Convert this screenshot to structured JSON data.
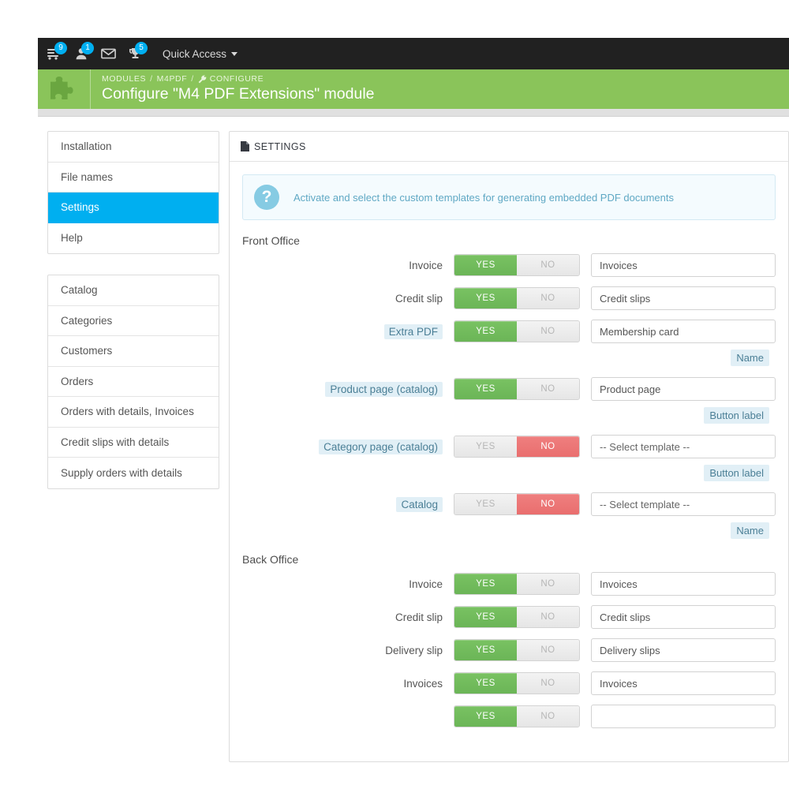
{
  "topbar": {
    "icons": [
      {
        "name": "cart-icon",
        "badge": "9"
      },
      {
        "name": "customers-icon",
        "badge": "1"
      },
      {
        "name": "mail-icon",
        "badge": ""
      },
      {
        "name": "trophy-icon",
        "badge": "5"
      }
    ],
    "quick_access_label": "Quick Access"
  },
  "header": {
    "module_icon": "puzzle-piece-icon",
    "breadcrumb": [
      {
        "label": "MODULES"
      },
      {
        "label": "M4PDF"
      },
      {
        "label": "CONFIGURE",
        "icon": "wrench-icon"
      }
    ],
    "separator": "/",
    "title": "Configure \"M4 PDF Extensions\" module"
  },
  "sidebar": {
    "panel_one": [
      {
        "label": "Installation",
        "active": false
      },
      {
        "label": "File names",
        "active": false
      },
      {
        "label": "Settings",
        "active": true
      },
      {
        "label": "Help",
        "active": false
      }
    ],
    "panel_two": [
      {
        "label": "Catalog"
      },
      {
        "label": "Categories"
      },
      {
        "label": "Customers"
      },
      {
        "label": "Orders"
      },
      {
        "label": "Orders with details, Invoices"
      },
      {
        "label": "Credit slips with details"
      },
      {
        "label": "Supply orders with details"
      }
    ]
  },
  "main": {
    "card_title": "SETTINGS",
    "card_icon": "document-icon",
    "alert": {
      "icon": "question-mark-icon",
      "text": "Activate and select the custom templates for generating embedded PDF documents"
    },
    "switch": {
      "yes_label": "YES",
      "no_label": "NO"
    },
    "sections": [
      {
        "title": "Front Office",
        "rows": [
          {
            "label": "Invoice",
            "highlight": false,
            "state": "yes",
            "value": "Invoices",
            "sub": null
          },
          {
            "label": "Credit slip",
            "highlight": false,
            "state": "yes",
            "value": "Credit slips",
            "sub": null
          },
          {
            "label": "Extra PDF",
            "highlight": true,
            "state": "yes",
            "value": "Membership card",
            "sub": "Name"
          },
          {
            "label": "Product page (catalog)",
            "highlight": true,
            "state": "yes",
            "value": "Product page",
            "sub": "Button label"
          },
          {
            "label": "Category page (catalog)",
            "highlight": true,
            "state": "no",
            "value": "-- Select template --",
            "sub": "Button label"
          },
          {
            "label": "Catalog",
            "highlight": true,
            "state": "no",
            "value": "-- Select template --",
            "sub": "Name"
          }
        ]
      },
      {
        "title": "Back Office",
        "rows": [
          {
            "label": "Invoice",
            "highlight": false,
            "state": "yes",
            "value": "Invoices",
            "sub": null
          },
          {
            "label": "Credit slip",
            "highlight": false,
            "state": "yes",
            "value": "Credit slips",
            "sub": null
          },
          {
            "label": "Delivery slip",
            "highlight": false,
            "state": "yes",
            "value": "Delivery slips",
            "sub": null
          },
          {
            "label": "Invoices",
            "highlight": false,
            "state": "yes",
            "value": "Invoices",
            "sub": null
          },
          {
            "label": "",
            "highlight": false,
            "state": "yes",
            "value": "",
            "sub": null
          }
        ]
      }
    ]
  },
  "colors": {
    "accent_blue": "#00aff0",
    "header_green": "#8ac45a",
    "toggle_yes": "#6bb557",
    "toggle_no": "#e96e6e",
    "tag_bg": "#e1eff6",
    "tag_text": "#4b7f96",
    "topbar_bg": "#212121"
  }
}
